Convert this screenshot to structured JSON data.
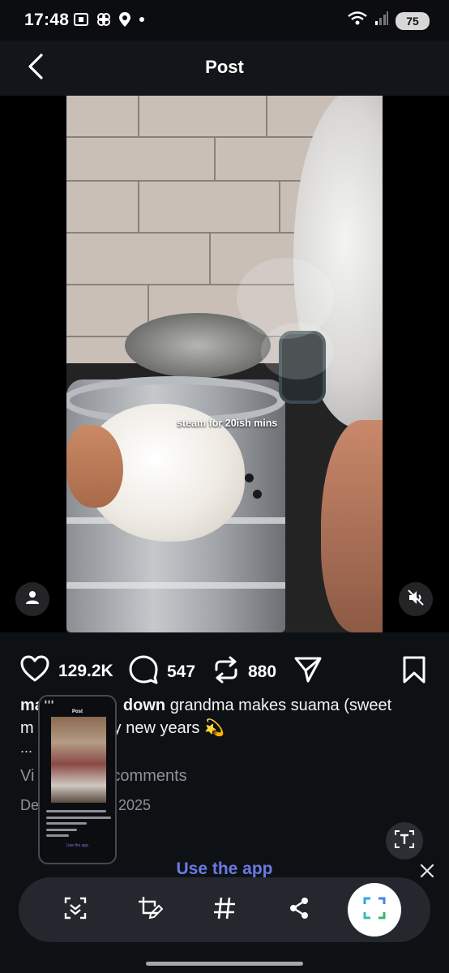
{
  "status_bar": {
    "time": "17:48",
    "battery": "75",
    "left_icons": [
      "screenshot-icon",
      "pinwheel-icon",
      "location-icon",
      "dot-icon"
    ],
    "right_icons": [
      "wifi-icon",
      "signal-icon",
      "battery-icon"
    ]
  },
  "header": {
    "title": "Post",
    "back_icon": "chevron-left-icon"
  },
  "video": {
    "overlay_text": "steam for 20ish mins",
    "left_button_icon": "person-icon",
    "right_button_icon": "muted-speaker-icon"
  },
  "actions": {
    "likes": "129.2K",
    "comments": "547",
    "reposts": "880",
    "icons": [
      "heart-icon",
      "comment-icon",
      "repost-icon",
      "send-icon",
      "bookmark-icon"
    ]
  },
  "caption": {
    "username": "ma",
    "username_tail": "down",
    "text_line1": "grandma makes suama (sweet",
    "text_line2_start": "m",
    "text_line2": "y new years 💫",
    "more": "..."
  },
  "comments": {
    "view_prefix": "Vi",
    "view_text": "comments"
  },
  "date": {
    "prefix": "De",
    "year": "2025"
  },
  "thumbnail": {
    "title": "Post",
    "link": "Use the app"
  },
  "banner": {
    "use_app": "Use the app"
  },
  "toolbar": {
    "icons": [
      "scan-text-icon",
      "edit-crop-icon",
      "hashtag-icon",
      "share-icon",
      "capture-icon"
    ]
  },
  "colors": {
    "background": "#0e1114",
    "link": "#6b79e6",
    "muted": "#8e9196"
  }
}
